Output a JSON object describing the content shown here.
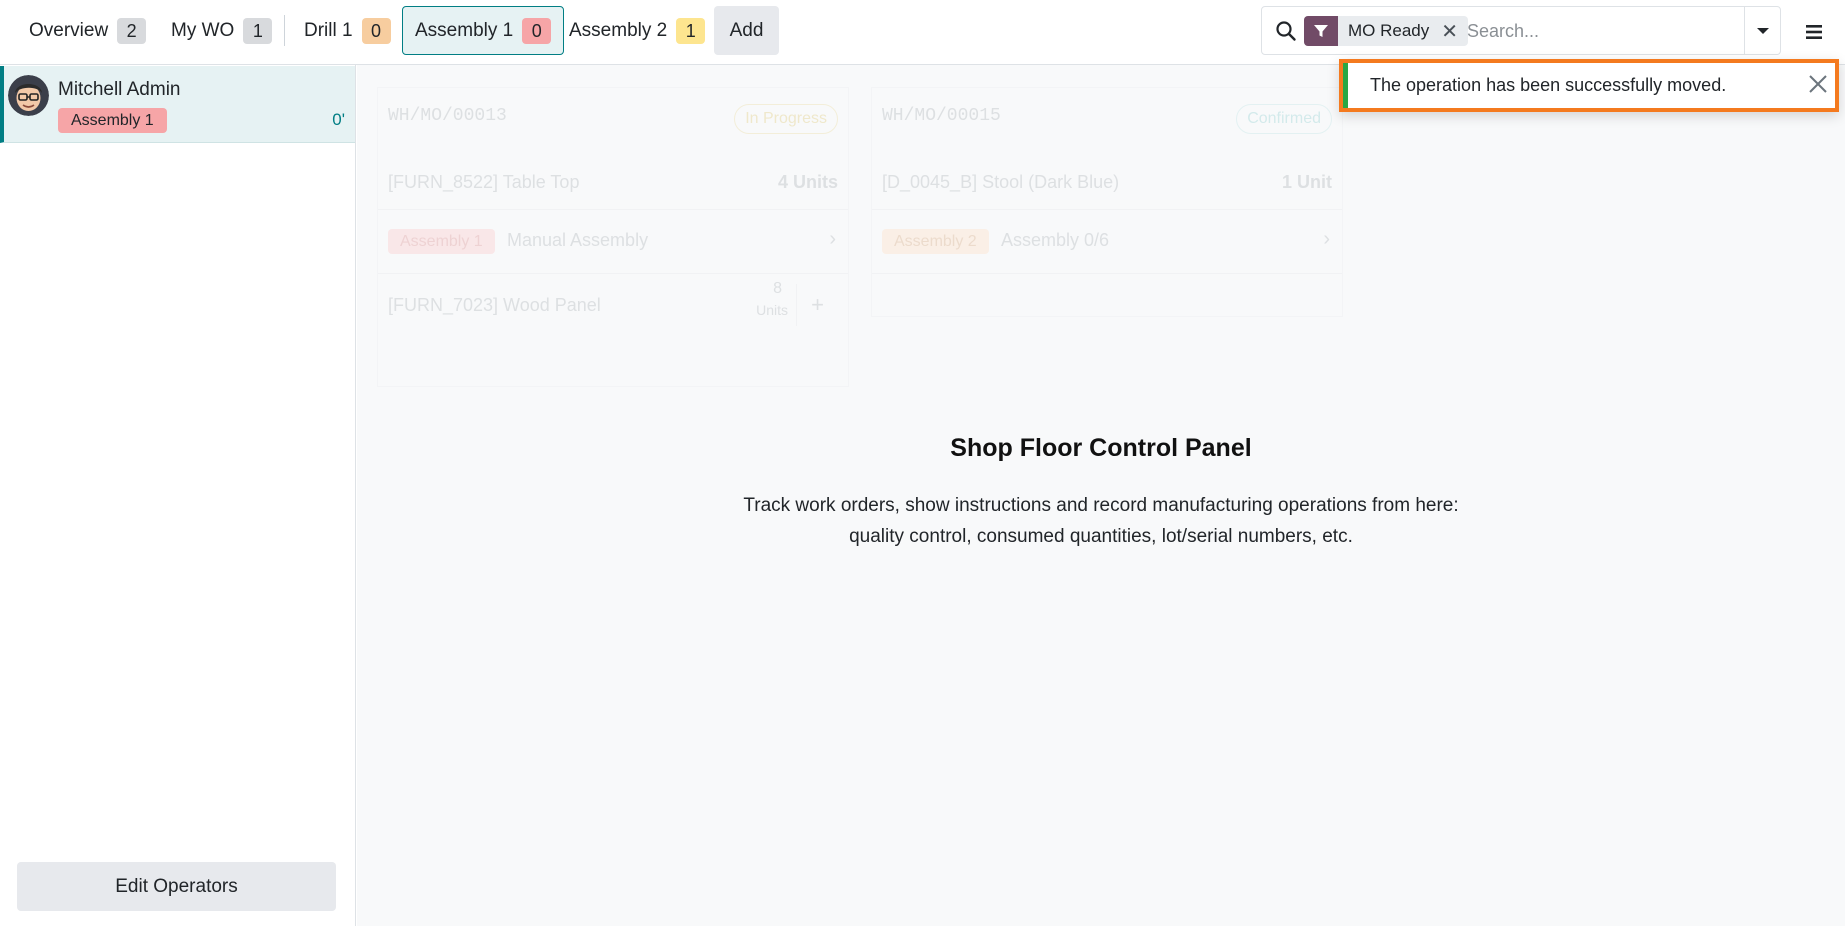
{
  "tabs": [
    {
      "label": "Overview",
      "count": "2",
      "color": "grey"
    },
    {
      "label": "My WO",
      "count": "1",
      "color": "grey"
    },
    {
      "label": "Drill 1",
      "count": "0",
      "color": "orange"
    },
    {
      "label": "Assembly 1",
      "count": "0",
      "color": "red",
      "active": true
    },
    {
      "label": "Assembly 2",
      "count": "1",
      "color": "yellow"
    }
  ],
  "add_label": "Add",
  "search": {
    "facet_label": "MO Ready",
    "placeholder": "Search..."
  },
  "sidebar": {
    "operator": {
      "name": "Mitchell Admin",
      "workcenter": "Assembly 1",
      "time": "0'"
    },
    "edit_label": "Edit Operators"
  },
  "cards": [
    {
      "mo": "WH/MO/00013",
      "state": "In Progress",
      "product": "[FURN_8522] Table Top",
      "qty": "4 Units",
      "workcenter": "Assembly 1",
      "operation": "Manual Assembly",
      "component": "[FURN_7023] Wood Panel",
      "component_qty": "8",
      "component_uom": "Units"
    },
    {
      "mo": "WH/MO/00015",
      "state": "Confirmed",
      "product": "[D_0045_B] Stool (Dark Blue)",
      "qty": "1 Unit",
      "workcenter": "Assembly 2",
      "operation": "Assembly 0/6"
    }
  ],
  "hero": {
    "title": "Shop Floor Control Panel",
    "line1": "Track work orders, show instructions and record manufacturing operations from here:",
    "line2": "quality control, consumed quantities, lot/serial numbers, etc."
  },
  "toast": {
    "message": "The operation has been successfully moved."
  },
  "colors": {
    "accent": "#017e84",
    "facet": "#714b67",
    "highlight": "#f47a1f",
    "success": "#28a745"
  }
}
